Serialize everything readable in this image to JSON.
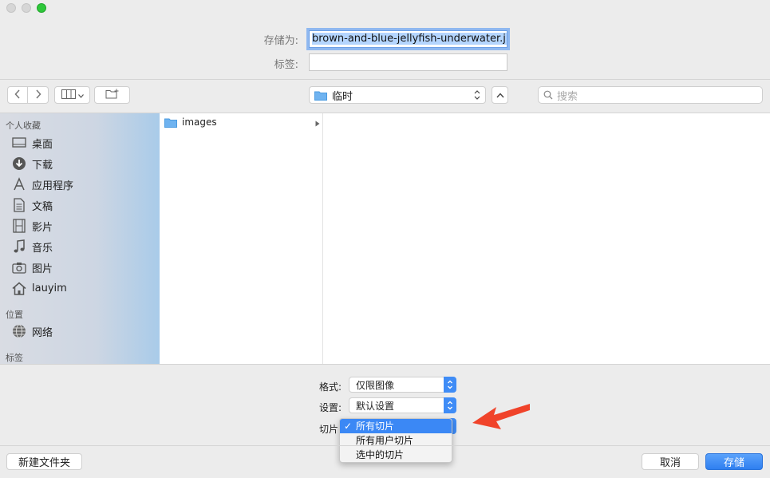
{
  "save": {
    "label": "存储为:",
    "filename": "brown-and-blue-jellyfish-underwater.jpg",
    "tags_label": "标签:",
    "tags_value": ""
  },
  "toolbar": {
    "location": "临时",
    "search_placeholder": "搜索"
  },
  "sidebar": {
    "favorites_header": "个人收藏",
    "items": [
      {
        "label": "桌面",
        "icon": "desktop-icon"
      },
      {
        "label": "下载",
        "icon": "download-icon"
      },
      {
        "label": "应用程序",
        "icon": "applications-icon"
      },
      {
        "label": "文稿",
        "icon": "documents-icon"
      },
      {
        "label": "影片",
        "icon": "movies-icon"
      },
      {
        "label": "音乐",
        "icon": "music-icon"
      },
      {
        "label": "图片",
        "icon": "pictures-icon"
      },
      {
        "label": "lauyim",
        "icon": "home-icon"
      }
    ],
    "locations_header": "位置",
    "network_label": "网络",
    "tags_header": "标签"
  },
  "browser": {
    "items": [
      {
        "name": "images",
        "type": "folder"
      }
    ]
  },
  "options": {
    "format_label": "格式:",
    "format_value": "仅限图像",
    "settings_label": "设置:",
    "settings_value": "默认设置",
    "slices_label": "切片",
    "slices_menu": [
      "所有切片",
      "所有用户切片",
      "选中的切片"
    ],
    "slices_selected_index": 0
  },
  "buttons": {
    "new_folder": "新建文件夹",
    "cancel": "取消",
    "save": "存储"
  },
  "colors": {
    "accent": "#3b88f5",
    "arrow": "#f0432a"
  }
}
